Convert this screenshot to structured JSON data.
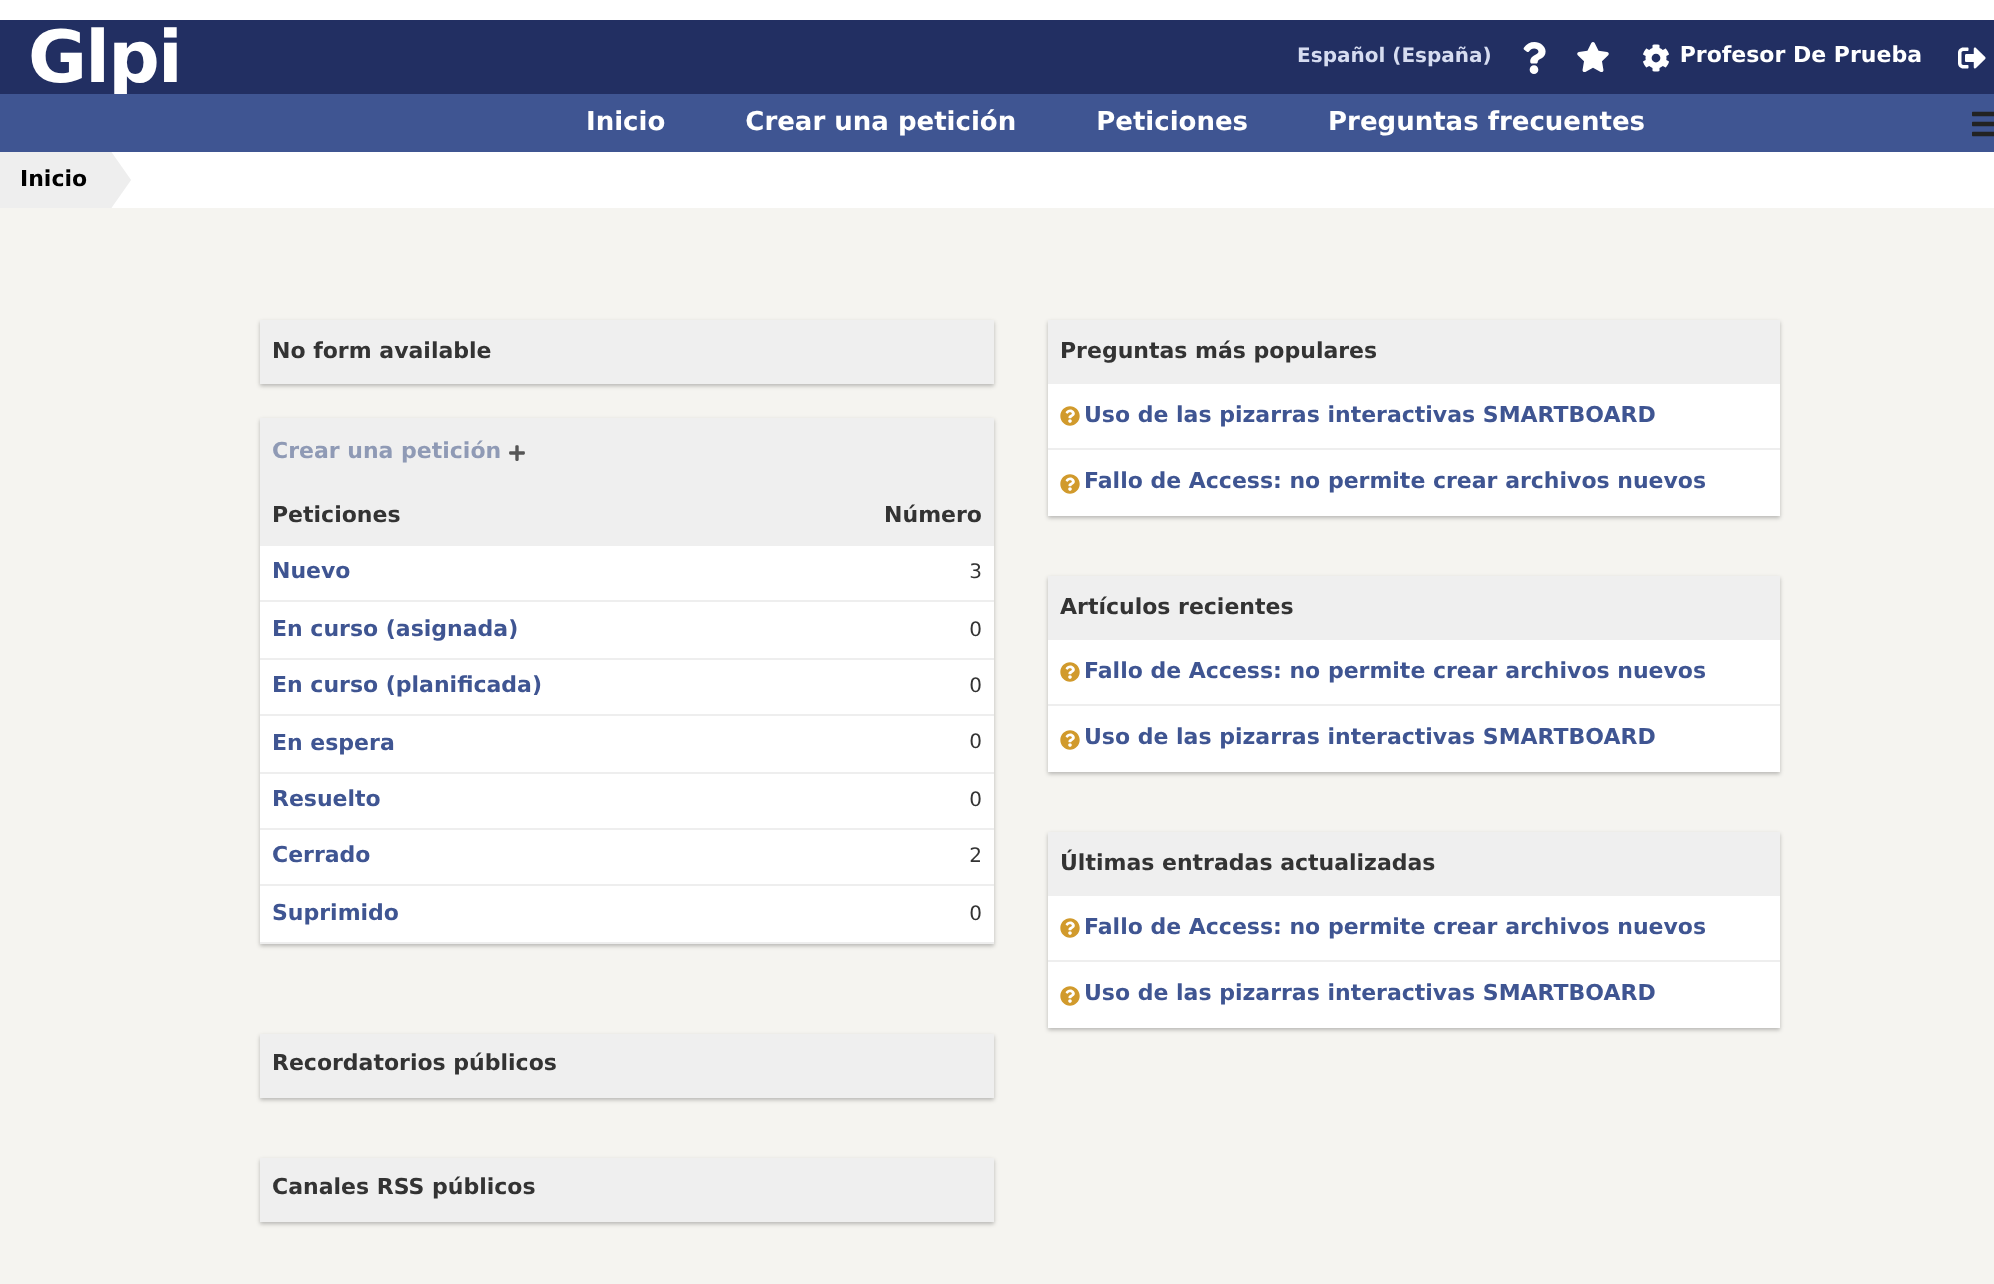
{
  "logo": {
    "text": "Glpi"
  },
  "top_bar": {
    "language": "Español (España)",
    "user": "Profesor De Prueba"
  },
  "menu": [
    {
      "label": "Inicio"
    },
    {
      "label": "Crear una petición"
    },
    {
      "label": "Peticiones"
    },
    {
      "label": "Preguntas frecuentes"
    }
  ],
  "breadcrumb": [
    "Inicio"
  ],
  "form_panel": {
    "title": "No form available"
  },
  "tickets_panel": {
    "create_link": "Crear una petición",
    "columns": [
      "Peticiones",
      "Número"
    ],
    "rows": [
      {
        "status": "Nuevo",
        "count": "3"
      },
      {
        "status": "En curso (asignada)",
        "count": "0"
      },
      {
        "status": "En curso (planificada)",
        "count": "0"
      },
      {
        "status": "En espera",
        "count": "0"
      },
      {
        "status": "Resuelto",
        "count": "0"
      },
      {
        "status": "Cerrado",
        "count": "2"
      },
      {
        "status": "Suprimido",
        "count": "0"
      }
    ]
  },
  "left_panels": [
    {
      "title": "Recordatorios públicos"
    },
    {
      "title": "Canales RSS públicos"
    }
  ],
  "faq_panels": [
    {
      "title": "Preguntas más populares",
      "items": [
        "Uso de las pizarras interactivas SMARTBOARD",
        "Fallo de Access: no permite crear archivos nuevos"
      ]
    },
    {
      "title": "Artículos recientes",
      "items": [
        "Fallo de Access: no permite crear archivos nuevos",
        "Uso de las pizarras interactivas SMARTBOARD"
      ]
    },
    {
      "title": "Últimas entradas actualizadas",
      "items": [
        "Fallo de Access: no permite crear archivos nuevos",
        "Uso de las pizarras interactivas SMARTBOARD"
      ]
    }
  ]
}
